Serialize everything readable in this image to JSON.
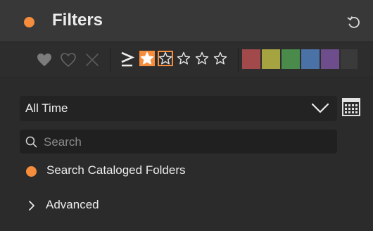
{
  "panel": {
    "title": "Filters",
    "dot_color": "#f58d3c",
    "reset_icon": "reset-icon"
  },
  "toolbar": {
    "flag_icons": [
      "heart-filled-icon",
      "heart-outline-icon",
      "close-icon"
    ],
    "rating_operator": "≥",
    "rating_stars_total": 5,
    "rating_selected": 1,
    "star_color": "#f58d3c",
    "color_labels": [
      "#a24a4b",
      "#a5a440",
      "#4a8a4a",
      "#4b72a6",
      "#6d4d8c",
      "#3a3a3a"
    ]
  },
  "date_filter": {
    "value": "All Time",
    "chevron_icon": "chevron-down-icon",
    "calendar_icon": "calendar-icon"
  },
  "search": {
    "placeholder": "Search",
    "value": ""
  },
  "scope_option": {
    "label": "Search Cataloged Folders",
    "dot_color": "#f58d3c"
  },
  "advanced": {
    "label": "Advanced",
    "icon": "chevron-right-icon"
  }
}
